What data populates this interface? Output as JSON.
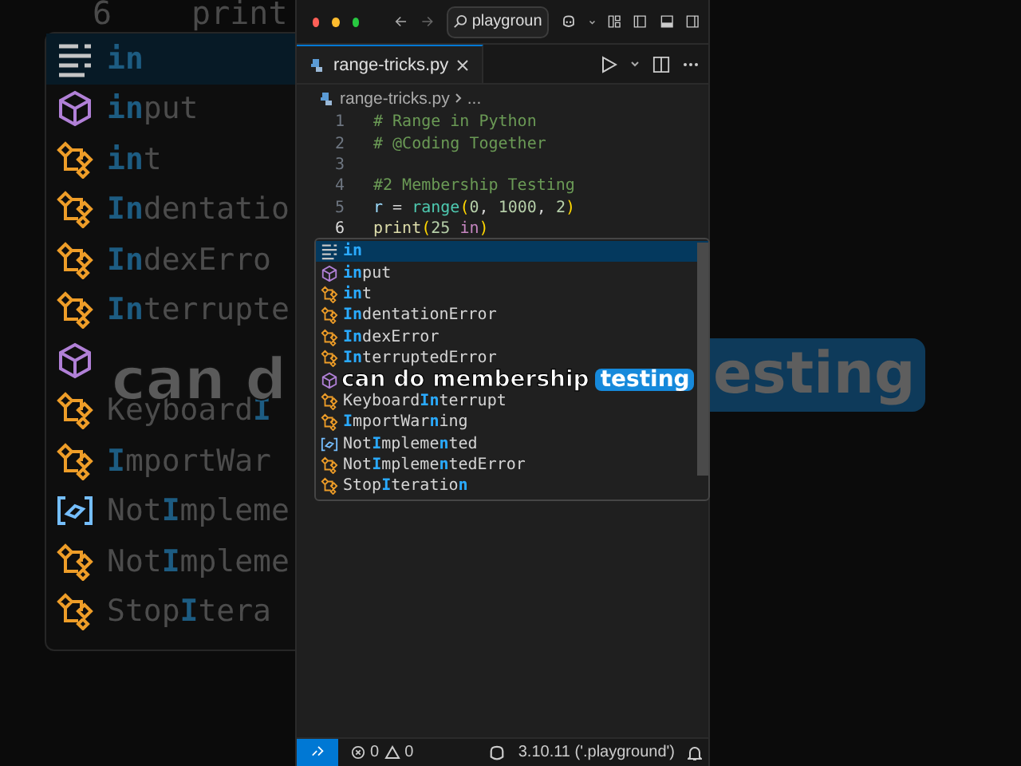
{
  "backdrop_left": {
    "line_number": "6",
    "code": "print",
    "items": [
      {
        "kind": "keyword",
        "text": "**in**",
        "selected": true
      },
      {
        "kind": "function",
        "text": "**in**put",
        "selected": false
      },
      {
        "kind": "class",
        "text": "**in**t",
        "selected": false
      },
      {
        "kind": "class",
        "text": "**In**dentatio",
        "selected": false
      },
      {
        "kind": "class",
        "text": "**In**dexErro",
        "selected": false
      },
      {
        "kind": "class",
        "text": "**In**terrupte",
        "selected": false
      },
      {
        "kind": "function",
        "selected": false
      },
      {
        "kind": "class",
        "text": "Keyboard**I**",
        "selected": false
      },
      {
        "kind": "class",
        "text": "**I**mportWar",
        "selected": false
      },
      {
        "kind": "variable",
        "text": "Not**I**mpleme",
        "selected": false
      },
      {
        "kind": "class",
        "text": "Not**I**mpleme",
        "selected": false
      },
      {
        "kind": "class",
        "text": "Stop**I**tera",
        "selected": false
      }
    ],
    "caption": "can d"
  },
  "backdrop_right": {
    "caption_highlight": "esting"
  },
  "titlebar": {
    "search": "playgroun"
  },
  "tabs": [
    {
      "label": "range-tricks.py",
      "selected": true
    }
  ],
  "breadcrumb": [
    "range-tricks.py",
    "..."
  ],
  "lines": [
    {
      "number": "1",
      "active": false,
      "tokens": [
        {
          "kind": "comment",
          "text": "# Range in Python"
        }
      ]
    },
    {
      "number": "2",
      "active": false,
      "tokens": [
        {
          "kind": "comment",
          "text": "# @Coding Together"
        }
      ]
    },
    {
      "number": "3",
      "active": false
    },
    {
      "number": "4",
      "active": false,
      "tokens": [
        {
          "kind": "comment",
          "text": "#2 Membership Testing"
        }
      ]
    },
    {
      "number": "5",
      "active": false,
      "tokens": [
        {
          "kind": "variable",
          "text": "r"
        },
        {
          "kind": "plain",
          "text": " = "
        },
        {
          "kind": "builtin",
          "text": "range"
        },
        {
          "kind": "paren",
          "text": "("
        },
        {
          "kind": "number",
          "text": "0"
        },
        {
          "kind": "plain",
          "text": ", "
        },
        {
          "kind": "number",
          "text": "1000"
        },
        {
          "kind": "plain",
          "text": ", "
        },
        {
          "kind": "number",
          "text": "2"
        },
        {
          "kind": "paren",
          "text": ")"
        }
      ]
    },
    {
      "number": "6",
      "active": true,
      "tokens": [
        {
          "kind": "function",
          "text": "print"
        },
        {
          "kind": "paren",
          "text": "("
        },
        {
          "kind": "number",
          "text": "25"
        },
        {
          "kind": "keyword",
          "text": " in"
        },
        {
          "kind": "paren",
          "text": ")"
        }
      ]
    }
  ],
  "suggestions": [
    {
      "kind": "keyword",
      "text": "**in**",
      "selected": true
    },
    {
      "kind": "function",
      "text": "**in**put",
      "selected": false
    },
    {
      "kind": "class",
      "text": "**in**t",
      "selected": false
    },
    {
      "kind": "class",
      "text": "**In**dentationError",
      "selected": false
    },
    {
      "kind": "class",
      "text": "**In**dexError",
      "selected": false
    },
    {
      "kind": "class",
      "text": "**In**terruptedError",
      "selected": false
    },
    {
      "kind": "function",
      "selected": false
    },
    {
      "kind": "class",
      "text": "Keyboard**In**terrupt",
      "selected": false
    },
    {
      "kind": "class",
      "text": "**I**mportWar**n**ing",
      "selected": false
    },
    {
      "kind": "variable",
      "text": "Not**I**mpleme**n**ted",
      "selected": false
    },
    {
      "kind": "class",
      "text": "Not**I**mpleme**n**tedError",
      "selected": false
    },
    {
      "kind": "class",
      "text": "Stop**I**teratio**n**",
      "selected": false
    }
  ],
  "caption": {
    "text": "can do membership",
    "highlight": "testing"
  },
  "status_bar": {
    "errors": "0",
    "warnings": "0",
    "interpreter": "3.10.11 ('.playground')"
  }
}
